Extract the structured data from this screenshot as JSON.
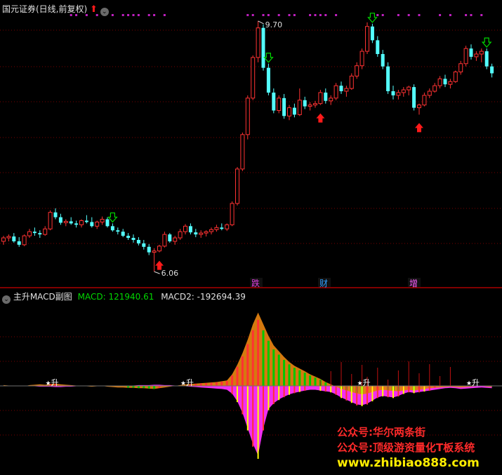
{
  "top_panel": {
    "title": "国元证券(日线,前复权)",
    "high_label": "9.70",
    "low_label": "6.06",
    "event_labels": [
      "跌",
      "财",
      "增"
    ]
  },
  "bottom_panel": {
    "title": "主升MACD副图",
    "macd_label": "MACD: 121940.61",
    "macd2_label": "MACD2: -192694.39",
    "signal_label": "升"
  },
  "watermark": {
    "line1": "公众号:华尔两条街",
    "line2": "公众号:顶级游资量化T板系统",
    "line3": "www.zhibiao888.com"
  },
  "colors": {
    "background": "#000000",
    "up": "#ff3232",
    "down": "#54ffff",
    "grid": "#7a0000",
    "separator": "#ff0000",
    "macd_label": "#00d800",
    "buy_arrow": "#ff1a1a",
    "sell_arrow": "#00d800",
    "dots": "#c020c0",
    "area_orange": "#e08010",
    "area_magenta": "#ff30ff",
    "bar_yellow": "#ffff00",
    "watermark_red": "#ff2a2a",
    "watermark_yellow": "#ffee00"
  },
  "chart_data": {
    "type": "candlestick",
    "price_high": 9.7,
    "price_low": 6.06,
    "candles": [
      [
        6.5,
        6.58,
        6.45,
        6.55
      ],
      [
        6.55,
        6.6,
        6.5,
        6.57
      ],
      [
        6.57,
        6.62,
        6.48,
        6.5
      ],
      [
        6.5,
        6.56,
        6.42,
        6.45
      ],
      [
        6.45,
        6.6,
        6.43,
        6.58
      ],
      [
        6.58,
        6.68,
        6.55,
        6.64
      ],
      [
        6.64,
        6.7,
        6.58,
        6.62
      ],
      [
        6.62,
        6.66,
        6.55,
        6.6
      ],
      [
        6.6,
        6.72,
        6.58,
        6.68
      ],
      [
        6.68,
        6.95,
        6.66,
        6.92
      ],
      [
        6.92,
        6.98,
        6.82,
        6.85
      ],
      [
        6.85,
        6.9,
        6.74,
        6.77
      ],
      [
        6.77,
        6.82,
        6.72,
        6.79
      ],
      [
        6.79,
        6.85,
        6.74,
        6.76
      ],
      [
        6.76,
        6.8,
        6.7,
        6.74
      ],
      [
        6.74,
        6.82,
        6.7,
        6.8
      ],
      [
        6.8,
        6.88,
        6.76,
        6.78
      ],
      [
        6.78,
        6.85,
        6.7,
        6.72
      ],
      [
        6.72,
        6.8,
        6.68,
        6.78
      ],
      [
        6.78,
        6.86,
        6.74,
        6.82
      ],
      [
        6.82,
        6.85,
        6.7,
        6.72
      ],
      [
        6.72,
        6.76,
        6.64,
        6.66
      ],
      [
        6.66,
        6.7,
        6.6,
        6.64
      ],
      [
        6.64,
        6.68,
        6.56,
        6.58
      ],
      [
        6.58,
        6.62,
        6.52,
        6.55
      ],
      [
        6.55,
        6.6,
        6.48,
        6.52
      ],
      [
        6.52,
        6.56,
        6.44,
        6.47
      ],
      [
        6.47,
        6.52,
        6.38,
        6.42
      ],
      [
        6.42,
        6.46,
        6.3,
        6.34
      ],
      [
        6.34,
        6.4,
        6.06,
        6.36
      ],
      [
        6.36,
        6.45,
        6.34,
        6.43
      ],
      [
        6.43,
        6.64,
        6.41,
        6.6
      ],
      [
        6.6,
        6.62,
        6.48,
        6.5
      ],
      [
        6.5,
        6.58,
        6.45,
        6.55
      ],
      [
        6.55,
        6.68,
        6.52,
        6.64
      ],
      [
        6.64,
        6.75,
        6.6,
        6.72
      ],
      [
        6.72,
        6.76,
        6.6,
        6.63
      ],
      [
        6.63,
        6.68,
        6.56,
        6.6
      ],
      [
        6.6,
        6.66,
        6.55,
        6.62
      ],
      [
        6.62,
        6.66,
        6.57,
        6.64
      ],
      [
        6.64,
        6.7,
        6.6,
        6.67
      ],
      [
        6.67,
        6.74,
        6.64,
        6.7
      ],
      [
        6.7,
        6.76,
        6.66,
        6.68
      ],
      [
        6.68,
        6.76,
        6.65,
        6.74
      ],
      [
        6.74,
        7.08,
        6.72,
        7.05
      ],
      [
        7.05,
        7.58,
        7.02,
        7.55
      ],
      [
        7.55,
        8.08,
        7.52,
        8.05
      ],
      [
        8.05,
        8.62,
        7.98,
        8.58
      ],
      [
        8.58,
        9.2,
        8.55,
        9.17
      ],
      [
        9.17,
        9.7,
        9.1,
        9.6
      ],
      [
        9.6,
        9.65,
        8.98,
        9.02
      ],
      [
        9.02,
        9.08,
        8.62,
        8.66
      ],
      [
        8.66,
        8.72,
        8.36,
        8.4
      ],
      [
        8.4,
        8.62,
        8.36,
        8.58
      ],
      [
        8.58,
        8.64,
        8.28,
        8.32
      ],
      [
        8.32,
        8.48,
        8.26,
        8.44
      ],
      [
        8.44,
        8.5,
        8.3,
        8.34
      ],
      [
        8.34,
        8.72,
        8.32,
        8.55
      ],
      [
        8.55,
        8.6,
        8.42,
        8.46
      ],
      [
        8.46,
        8.52,
        8.4,
        8.48
      ],
      [
        8.48,
        8.54,
        8.44,
        8.5
      ],
      [
        8.5,
        8.7,
        8.48,
        8.66
      ],
      [
        8.66,
        8.72,
        8.5,
        8.54
      ],
      [
        8.54,
        8.62,
        8.48,
        8.58
      ],
      [
        8.58,
        8.8,
        8.55,
        8.76
      ],
      [
        8.76,
        8.82,
        8.64,
        8.68
      ],
      [
        8.68,
        8.76,
        8.6,
        8.72
      ],
      [
        8.72,
        8.94,
        8.7,
        8.9
      ],
      [
        8.9,
        9.1,
        8.86,
        9.05
      ],
      [
        9.05,
        9.3,
        9.0,
        9.26
      ],
      [
        9.26,
        9.68,
        9.22,
        9.62
      ],
      [
        9.62,
        9.66,
        9.38,
        9.42
      ],
      [
        9.42,
        9.48,
        9.18,
        9.22
      ],
      [
        9.22,
        9.28,
        9.0,
        9.04
      ],
      [
        9.04,
        9.1,
        8.64,
        8.68
      ],
      [
        8.68,
        8.76,
        8.56,
        8.62
      ],
      [
        8.62,
        8.7,
        8.56,
        8.66
      ],
      [
        8.66,
        8.74,
        8.6,
        8.7
      ],
      [
        8.7,
        8.76,
        8.62,
        8.74
      ],
      [
        8.74,
        8.78,
        8.4,
        8.44
      ],
      [
        8.44,
        8.5,
        8.34,
        8.48
      ],
      [
        8.48,
        8.66,
        8.46,
        8.62
      ],
      [
        8.62,
        8.72,
        8.58,
        8.68
      ],
      [
        8.68,
        8.8,
        8.66,
        8.76
      ],
      [
        8.76,
        8.9,
        8.72,
        8.86
      ],
      [
        8.86,
        8.92,
        8.74,
        8.78
      ],
      [
        8.78,
        8.86,
        8.72,
        8.82
      ],
      [
        8.82,
        8.98,
        8.8,
        8.96
      ],
      [
        8.96,
        9.12,
        8.92,
        9.08
      ],
      [
        9.08,
        9.34,
        9.04,
        9.3
      ],
      [
        9.3,
        9.36,
        9.14,
        9.18
      ],
      [
        9.18,
        9.26,
        9.12,
        9.22
      ],
      [
        9.22,
        9.3,
        9.1,
        9.26
      ],
      [
        9.26,
        9.3,
        9.0,
        9.04
      ],
      [
        9.04,
        9.08,
        8.88,
        8.94
      ]
    ],
    "buy_signal_indices": [
      30,
      61,
      80
    ],
    "sell_signal_indices": [
      21,
      51,
      71,
      93
    ],
    "macd_area": [
      0.02,
      0.01,
      0.01,
      0,
      -0.01,
      0.02,
      0.03,
      0.04,
      0.03,
      0.05,
      0.06,
      0.04,
      0.03,
      0.02,
      0.01,
      0,
      -0.01,
      -0.02,
      -0.01,
      0,
      -0.02,
      -0.03,
      -0.04,
      -0.04,
      -0.05,
      -0.05,
      -0.06,
      -0.06,
      -0.07,
      -0.08,
      -0.06,
      -0.04,
      -0.02,
      0,
      0.02,
      0.04,
      0.05,
      0.06,
      0.07,
      0.08,
      0.09,
      0.1,
      0.12,
      0.14,
      0.3,
      0.55,
      0.85,
      1.2,
      1.6,
      1.9,
      1.6,
      1.3,
      1.05,
      0.9,
      0.75,
      0.62,
      0.52,
      0.45,
      0.38,
      0.3,
      0.24,
      0.18,
      0.1,
      0.04,
      -0.02,
      -0.08,
      -0.12,
      -0.16,
      -0.2,
      -0.22,
      -0.2,
      -0.16,
      -0.12,
      -0.1,
      -0.12,
      -0.13,
      -0.14,
      -0.12,
      -0.1,
      -0.12,
      -0.1,
      -0.08,
      -0.06,
      -0.05,
      -0.04,
      -0.03,
      -0.02,
      -0.03,
      -0.04,
      -0.03,
      -0.02,
      -0.01,
      0,
      -0.02,
      -0.03
    ],
    "macd2_area": [
      -0.01,
      -0.01,
      0,
      0,
      0,
      0,
      -0.01,
      -0.02,
      -0.02,
      -0.02,
      -0.03,
      -0.03,
      -0.02,
      -0.02,
      -0.01,
      -0.01,
      0,
      0,
      -0.01,
      -0.01,
      0,
      0,
      0,
      0.01,
      0.01,
      0.01,
      0.02,
      0.02,
      0.02,
      0.03,
      0.03,
      0.02,
      0.02,
      0.01,
      0,
      -0.01,
      -0.02,
      -0.03,
      -0.04,
      -0.05,
      -0.06,
      -0.07,
      -0.08,
      -0.1,
      -0.2,
      -0.4,
      -0.7,
      -1.1,
      -1.5,
      -1.8,
      -1.1,
      -0.6,
      -0.45,
      -0.35,
      -0.28,
      -0.22,
      -0.18,
      -0.15,
      -0.12,
      -0.1,
      -0.1,
      -0.12,
      -0.14,
      -0.16,
      -0.22,
      -0.3,
      -0.36,
      -0.42,
      -0.48,
      -0.5,
      -0.46,
      -0.38,
      -0.3,
      -0.26,
      -0.28,
      -0.3,
      -0.26,
      -0.2,
      -0.16,
      -0.18,
      -0.16,
      -0.14,
      -0.12,
      -0.1,
      -0.08,
      -0.06,
      -0.05,
      -0.06,
      -0.08,
      -0.07,
      -0.06,
      -0.05,
      -0.04,
      -0.05,
      -0.06
    ]
  }
}
